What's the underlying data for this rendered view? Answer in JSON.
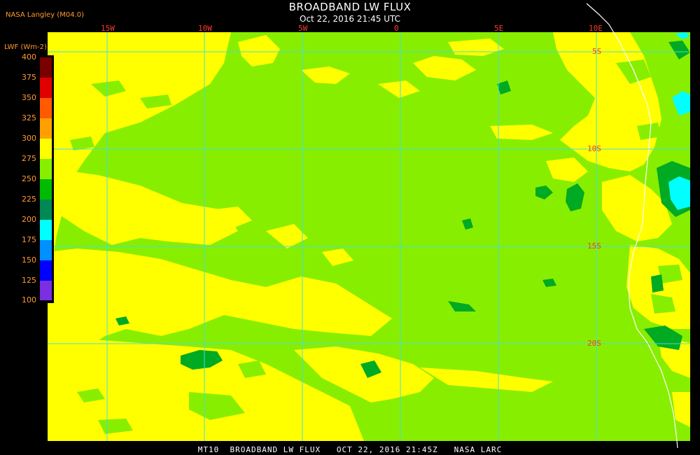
{
  "header": {
    "title": "BROADBAND LW FLUX",
    "subtitle": "Oct 22, 2016 21:45 UTC",
    "producer": "NASA Langley (M04.0)"
  },
  "colorbar": {
    "title": "LWF (Wm-2)",
    "labels": [
      "400",
      "375",
      "350",
      "325",
      "300",
      "275",
      "250",
      "225",
      "200",
      "175",
      "150",
      "125",
      "100"
    ],
    "colors": [
      "#7a0000",
      "#e00000",
      "#ff5a00",
      "#ffa000",
      "#ffff00",
      "#88ee00",
      "#00bb00",
      "#008855",
      "#00ffff",
      "#0090ff",
      "#0000ff",
      "#7b2fe0"
    ]
  },
  "grid": {
    "lon_labels": [
      "15W",
      "10W",
      "5W",
      "0",
      "5E",
      "10E"
    ],
    "lat_labels": [
      "5S",
      "10S",
      "15S",
      "20S"
    ]
  },
  "map_colors": {
    "yellow": "#ffff00",
    "green": "#88ee00",
    "dark_green": "#00aa22",
    "cyan": "#00ffff",
    "grid": "#40e0e0",
    "coast": "#ffffff"
  },
  "footer": {
    "text": "MT10  BROADBAND LW FLUX   OCT 22, 2016 21:45Z   NASA LARC"
  }
}
